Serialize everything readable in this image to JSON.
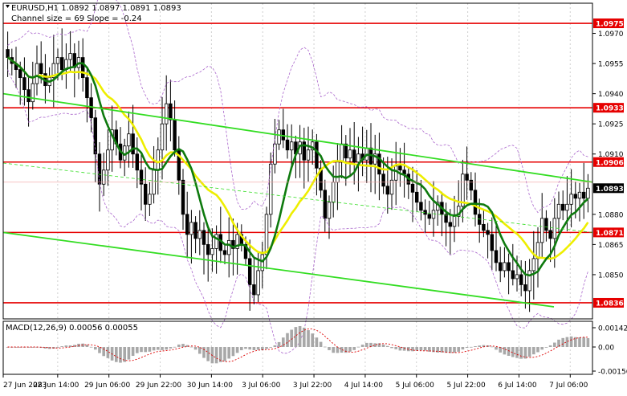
{
  "header": {
    "symbol_line": "EURUSD,H1  1.0892 1.0897 1.0891 1.0893",
    "channel_line": "Channel size = 69 Slope = -0.24"
  },
  "macd": {
    "label": "MACD(12,26,9) 0.00056 0.00055",
    "axis_ticks": [
      "0.00142",
      "0.00",
      "-0.00156"
    ]
  },
  "colors": {
    "background": "#ffffff",
    "level_red": "#e60000",
    "channel_green": "#33dd22",
    "ma_fast": "#0e7a0e",
    "ma_slow": "#eeee00",
    "bollinger": "#aa66cc",
    "candle": "#000000",
    "macd_hist": "#a8a8a8",
    "macd_signal": "#dd0000"
  },
  "chart_data": {
    "type": "candlestick",
    "symbol": "EURUSD",
    "timeframe": "H1",
    "last": {
      "open": 1.0892,
      "high": 1.0897,
      "low": 1.0891,
      "close": 1.0893
    },
    "ylim": [
      1.0828,
      1.0985
    ],
    "y_ticks": [
      "1.0970",
      "1.0955",
      "1.0940",
      "1.0925",
      "1.0910",
      "1.0880",
      "1.0865",
      "1.0850"
    ],
    "x_ticks": [
      "27 Jun 2023",
      "28 Jun 14:00",
      "29 Jun 06:00",
      "29 Jun 22:00",
      "30 Jun 14:00",
      "3 Jul 06:00",
      "3 Jul 22:00",
      "4 Jul 14:00",
      "5 Jul 06:00",
      "5 Jul 22:00",
      "6 Jul 14:00",
      "7 Jul 06:00"
    ],
    "levels": [
      {
        "label": "1.0975",
        "value": 1.0975
      },
      {
        "label": "1.0933",
        "value": 1.0933
      },
      {
        "label": "1.0906",
        "value": 1.0906
      },
      {
        "label": "1.0871",
        "value": 1.0871
      },
      {
        "label": "1.0836",
        "value": 1.0836
      }
    ],
    "price_marker": {
      "label": "1.0893",
      "value": 1.0893
    },
    "hidden_marker_value": 1.0896,
    "candles_close": [
      1.0958,
      1.0955,
      1.0952,
      1.0948,
      1.0942,
      1.0936,
      1.0945,
      1.0955,
      1.095,
      1.0944,
      1.0948,
      1.0955,
      1.0958,
      1.0952,
      1.0957,
      1.096,
      1.0953,
      1.0958,
      1.0948,
      1.0938,
      1.0928,
      1.091,
      1.0895,
      1.0902,
      1.0912,
      1.0922,
      1.0915,
      1.0907,
      1.0914,
      1.092,
      1.091,
      1.0902,
      1.0895,
      1.0885,
      1.089,
      1.0902,
      1.0912,
      1.0925,
      1.0935,
      1.0927,
      1.0912,
      1.0897,
      1.088,
      1.087,
      1.0876,
      1.0868,
      1.0872,
      1.0865,
      1.086,
      1.0863,
      1.087,
      1.0862,
      1.086,
      1.0867,
      1.0863,
      1.087,
      1.0865,
      1.0858,
      1.0845,
      1.084,
      1.0852,
      1.086,
      1.088,
      1.0905,
      1.0915,
      1.0922,
      1.0917,
      1.0912,
      1.0916,
      1.091,
      1.0916,
      1.0907,
      1.0912,
      1.0916,
      1.0903,
      1.0892,
      1.0878,
      1.0886,
      1.0896,
      1.0906,
      1.0915,
      1.0908,
      1.0912,
      1.0906,
      1.091,
      1.0907,
      1.0913,
      1.0905,
      1.091,
      1.09,
      1.0894,
      1.089,
      1.0897,
      1.0904,
      1.0902,
      1.09,
      1.0895,
      1.0891,
      1.0886,
      1.0882,
      1.088,
      1.0878,
      1.0882,
      1.0886,
      1.088,
      1.0876,
      1.0874,
      1.0879,
      1.0884,
      1.09,
      1.0897,
      1.0892,
      1.088,
      1.0875,
      1.0872,
      1.087,
      1.0862,
      1.0856,
      1.0852,
      1.0856,
      1.0852,
      1.0848,
      1.085,
      1.0845,
      1.0842,
      1.0852,
      1.0858,
      1.0866,
      1.0878,
      1.0872,
      1.0868,
      1.0878,
      1.0885,
      1.0882,
      1.0885,
      1.089,
      1.0888,
      1.0891,
      1.0888,
      1.0893
    ]
  }
}
